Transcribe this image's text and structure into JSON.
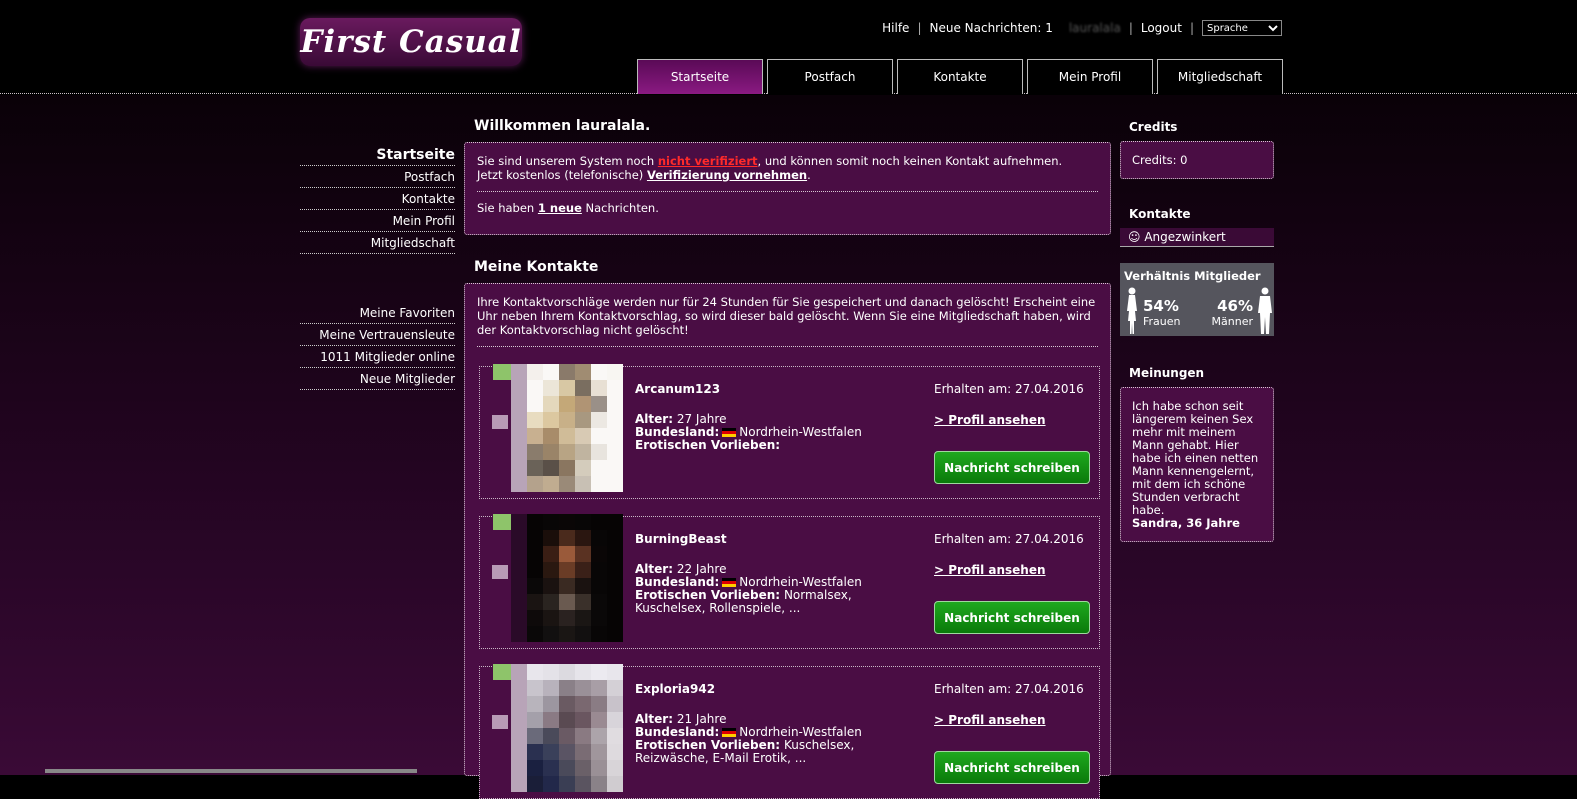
{
  "brand": {
    "logo_text": "First Casual"
  },
  "topnav": {
    "help": "Hilfe",
    "messages": "Neue Nachrichten: 1",
    "user": "lauralala",
    "logout": "Logout",
    "language": "Sprache"
  },
  "tabs": [
    "Startseite",
    "Postfach",
    "Kontakte",
    "Mein Profil",
    "Mitgliedschaft"
  ],
  "leftnav": {
    "heading": "Startseite",
    "items": [
      "Postfach",
      "Kontakte",
      "Mein Profil",
      "Mitgliedschaft"
    ],
    "items2": [
      "Meine Favoriten",
      "Meine Vertrauensleute",
      "1011 Mitglieder online",
      "Neue Mitglieder"
    ]
  },
  "welcome": {
    "title": "Willkommen lauralala.",
    "line1_pre": "Sie sind unserem System noch ",
    "line1_link": "nicht verifiziert",
    "line1_post": ", und können somit noch keinen Kontakt aufnehmen.",
    "line2_pre": "Jetzt kostenlos (telefonische) ",
    "line2_link": "Verifizierung vornehmen",
    "line2_post": ".",
    "line3_pre": "Sie haben ",
    "line3_link": "1 neue",
    "line3_post": " Nachrichten."
  },
  "contacts": {
    "title": "Meine Kontakte",
    "notice": "Ihre Kontaktvorschläge werden nur für 24 Stunden für Sie gespeichert und danach gelöscht! Erscheint eine Uhr neben Ihrem Kontaktvorschlag, so wird dieser bald gelöscht. Wenn Sie eine Mitgliedschaft haben, wird der Kontaktvorschlag nicht gelöscht!",
    "labels": {
      "age": "Alter:",
      "state": "Bundesland:",
      "erotic": "Erotischen Vorlieben:",
      "received": "Erhalten am:",
      "profile": "> Profil ansehen",
      "write": "Nachricht schreiben"
    },
    "items": [
      {
        "name": "Arcanum123",
        "age": "27 Jahre",
        "state": "Nordrhein-Westfalen",
        "erotic": "",
        "received": "27.04.2016",
        "pixels": [
          "#b8a4b8",
          "#f4f0ec",
          "#faf8f6",
          "#8a7a6a",
          "#a08c72",
          "#faf8f6",
          "#f8f6f2",
          "#b8a4b8",
          "#faf8f6",
          "#ece6d8",
          "#d8c8a4",
          "#7a6e60",
          "#e8e0d4",
          "#faf8f6",
          "#b8a4b8",
          "#faf8f6",
          "#e4d8bc",
          "#c4a878",
          "#b09474",
          "#9a9088",
          "#faf8f6",
          "#b8a4b8",
          "#e8dcc0",
          "#dcc8a0",
          "#c8b088",
          "#a89880",
          "#ece8e2",
          "#faf8f6",
          "#b8a4b8",
          "#c8b090",
          "#a88c6a",
          "#d0bc98",
          "#d8cab4",
          "#faf8f6",
          "#faf8f6",
          "#b8a4b8",
          "#8a7c6c",
          "#9a8468",
          "#b8a484",
          "#c0b4a0",
          "#e8e4de",
          "#faf8f6",
          "#b8a4b8",
          "#6a6258",
          "#5a5048",
          "#8a7660",
          "#d4ccbc",
          "#faf8f6",
          "#faf8f6",
          "#b8a4b8",
          "#b4a28c",
          "#c0ac90",
          "#9a8a78",
          "#c8c0b4",
          "#faf8f6",
          "#faf8f6"
        ]
      },
      {
        "name": "BurningBeast",
        "age": "22 Jahre",
        "state": "Nordrhein-Westfalen",
        "erotic": "Normalsex, Kuschelsex, Rollenspiele, ...",
        "received": "27.04.2016",
        "pixels": [
          "#2a0a28",
          "#060404",
          "#080606",
          "#0a0606",
          "#080606",
          "#060404",
          "#060404",
          "#2a0a28",
          "#060404",
          "#1a0e0a",
          "#4a2a1c",
          "#2a1610",
          "#080606",
          "#060404",
          "#2a0a28",
          "#060404",
          "#3a1e14",
          "#9a5a3a",
          "#5a3222",
          "#0a0606",
          "#060404",
          "#2a0a28",
          "#060404",
          "#2a1810",
          "#6a3c26",
          "#3a2018",
          "#080606",
          "#060404",
          "#2a0a28",
          "#0a0808",
          "#1a1210",
          "#3a2a22",
          "#1a1210",
          "#080606",
          "#060404",
          "#2a0a28",
          "#1a1412",
          "#2a2420",
          "#6a5a50",
          "#3a302a",
          "#0a0808",
          "#060404",
          "#2a0a28",
          "#0e0a0a",
          "#1a1412",
          "#2a2220",
          "#1a1614",
          "#0a0808",
          "#060404",
          "#2a0a28",
          "#0a0808",
          "#121010",
          "#1a1614",
          "#121010",
          "#080606",
          "#060404"
        ]
      },
      {
        "name": "Exploria942",
        "age": "21 Jahre",
        "state": "Nordrhein-Westfalen",
        "erotic": "Kuschelsex, Reizwäsche, E-Mail Erotik, ...",
        "received": "27.04.2016",
        "pixels": [
          "#b8a4b8",
          "#e8e6ec",
          "#e4e2e8",
          "#dcdae0",
          "#e6e4ea",
          "#eceaf0",
          "#e8e6ec",
          "#b8a4b8",
          "#c8c4cc",
          "#b8b2bc",
          "#8a8088",
          "#9a9098",
          "#a89ea6",
          "#d4d0d6",
          "#b8a4b8",
          "#b8b4bc",
          "#9c96a0",
          "#6a5a62",
          "#7a6870",
          "#8a7c84",
          "#c8c2ca",
          "#b8a4b8",
          "#a4a0aa",
          "#8a7a84",
          "#5a4a52",
          "#6a5660",
          "#9a8a92",
          "#d8d4da",
          "#b8a4b8",
          "#6a6a7a",
          "#4a4a5a",
          "#6a5a64",
          "#8a7a82",
          "#aca4aa",
          "#e0dce0",
          "#b8a4b8",
          "#2a3050",
          "#3a405a",
          "#5a5464",
          "#7a6c74",
          "#a0969c",
          "#dedade",
          "#b8a4b8",
          "#1a2040",
          "#2a3050",
          "#4a4a5a",
          "#6a6068",
          "#9a9096",
          "#d8d4d8",
          "#b8a4b8",
          "#1a1e38",
          "#22284a",
          "#3a3e54",
          "#5a5460",
          "#8a8288",
          "#d0ccd0"
        ]
      }
    ]
  },
  "right": {
    "credits_title": "Credits",
    "credits_text": "Credits: 0",
    "contacts_title": "Kontakte",
    "wink": "☺ Angezwinkert",
    "ratio_title": "Verhältnis Mitglieder",
    "women_pct": "54%",
    "women_label": "Frauen",
    "men_pct": "46%",
    "men_label": "Männer",
    "opinions_title": "Meinungen",
    "opinion_text": "Ich habe schon seit längerem keinen Sex mehr mit meinem Mann gehabt. Hier habe ich einen netten Mann kennengelernt, mit dem ich schöne Stunden verbracht habe.",
    "opinion_author": "Sandra, 36 Jahre"
  },
  "colors": {
    "accent": "#4a0d44",
    "button": "#1fa81f",
    "alert": "#ff2a2a"
  }
}
